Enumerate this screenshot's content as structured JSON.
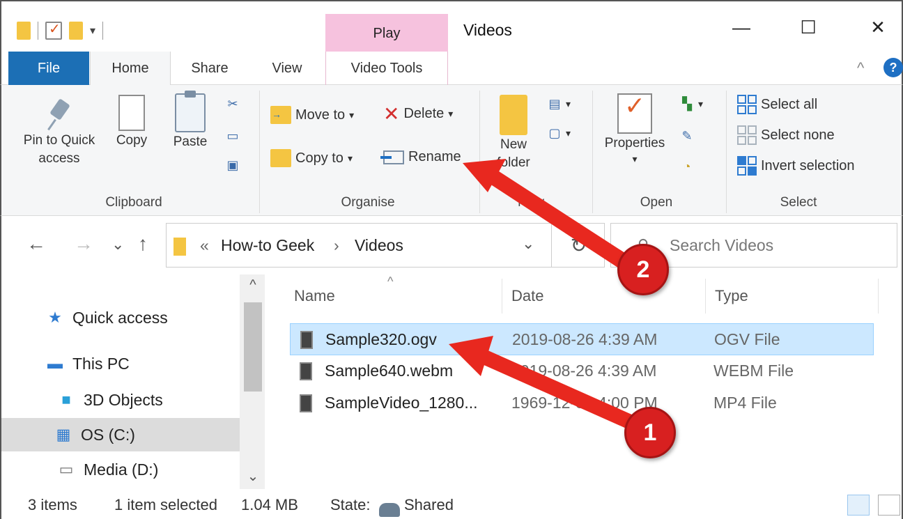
{
  "window": {
    "title": "Videos",
    "context_tab": "Play",
    "controls": {
      "minimize": "—",
      "maximize": "☐",
      "close": "✕"
    }
  },
  "quick_access_toolbar": {
    "dropdown": "▾"
  },
  "ribbon_tabs": {
    "file": "File",
    "home": "Home",
    "share": "Share",
    "view": "View",
    "video_tools": "Video Tools",
    "collapse": "^",
    "help": "?"
  },
  "ribbon": {
    "clipboard": {
      "label": "Clipboard",
      "pin_line1": "Pin to Quick",
      "pin_line2": "access",
      "copy": "Copy",
      "paste": "Paste"
    },
    "organise": {
      "label": "Organise",
      "move_to": "Move to",
      "copy_to": "Copy to",
      "delete": "Delete",
      "rename": "Rename",
      "dropdown": "▾"
    },
    "new": {
      "label": "New",
      "new_folder_line1": "New",
      "new_folder_line2": "folder"
    },
    "open": {
      "label": "Open",
      "properties": "Properties",
      "dropdown": "▾"
    },
    "select": {
      "label": "Select",
      "select_all": "Select all",
      "select_none": "Select none",
      "invert_selection": "Invert selection"
    }
  },
  "address_bar": {
    "back": "←",
    "forward": "→",
    "recent": "⌄",
    "up": "↑",
    "overflow": "«",
    "crumb1": "How-to Geek",
    "sep": "›",
    "crumb2": "Videos",
    "dropdown": "⌄",
    "refresh": "↻"
  },
  "search": {
    "placeholder": "Search Videos",
    "icon": "⚲"
  },
  "nav_pane": {
    "items": [
      {
        "label": "Quick access",
        "icon": "★"
      },
      {
        "label": "This PC",
        "icon": "🖥"
      },
      {
        "label": "3D Objects",
        "icon": "■"
      },
      {
        "label": "OS (C:)",
        "icon": "▦"
      },
      {
        "label": "Media (D:)",
        "icon": "▭"
      }
    ],
    "scroll_up": "^",
    "scroll_down": "⌄"
  },
  "file_list": {
    "columns": {
      "name": "Name",
      "date": "Date",
      "type": "Type"
    },
    "sort_indicator": "^",
    "rows": [
      {
        "name": "Sample320.ogv",
        "date": "2019-08-26 4:39 AM",
        "type": "OGV File",
        "selected": true
      },
      {
        "name": "Sample640.webm",
        "date": "2019-08-26 4:39 AM",
        "type": "WEBM File",
        "selected": false
      },
      {
        "name": "SampleVideo_1280...",
        "date": "1969-12-31 4:00 PM",
        "type": "MP4 File",
        "selected": false
      }
    ]
  },
  "status_bar": {
    "items_count": "3 items",
    "selection": "1 item selected",
    "size": "1.04 MB",
    "state_label": "State:",
    "state_value": "Shared"
  },
  "annotations": {
    "badge1": "1",
    "badge2": "2",
    "arrow_color": "#e8281f"
  },
  "colors": {
    "file_tab": "#1c6fb5",
    "play_tab": "#f6c2de",
    "selection": "#cce8ff",
    "folder": "#f4c542"
  }
}
